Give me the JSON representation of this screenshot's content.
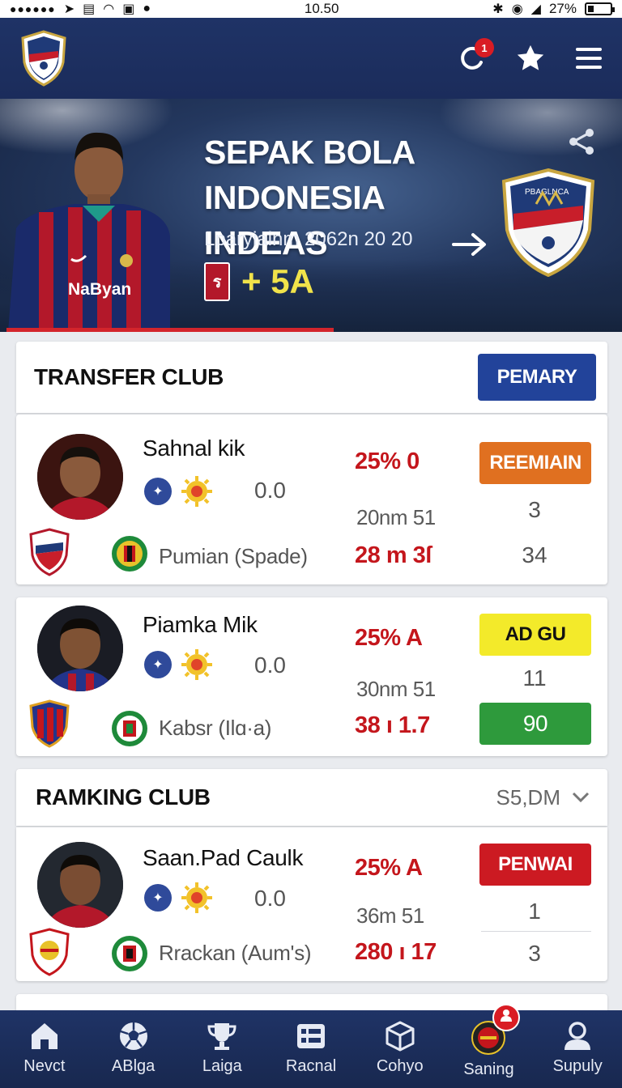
{
  "status_bar": {
    "time": "10.50",
    "battery": "27%"
  },
  "app_bar": {
    "notification_count": "1"
  },
  "hero": {
    "title_line1": "SEPAK BOLA INDONESIA",
    "title_line2": "INDEAS",
    "subtitle": "Lparyiainm 2062n 20 20",
    "score_icon": "ร",
    "score_value": "+ 5A",
    "crest_text": "PBAGLNCA",
    "jersey_text": "NaByan"
  },
  "transfer_section": {
    "title": "TRANSFER CLUB",
    "button_label": "PEMARY",
    "button_color": "#22439a",
    "players": [
      {
        "name": "Sahnal kik",
        "rating": "0.0",
        "league": "Pumian (Sраde)",
        "stat1": "25% 0",
        "stat2": "20nm 51",
        "stat3": "28 m 3ſ",
        "badge": "REEMIAIN",
        "badge_color": "#e07020",
        "right1": "3",
        "right2": "34"
      },
      {
        "name": "Piamka Mik",
        "rating": "0.0",
        "league": "Kabsr (Ilɑ·a)",
        "stat1": "25% A",
        "stat2": "30nm 51",
        "stat3": "38 ı 1.7",
        "badge": "AD GU",
        "badge_color": "#f3ea2a",
        "right1": "11",
        "right2": "90",
        "right2_color": "#2e9a3c"
      }
    ]
  },
  "ranking_section": {
    "title": "RAMKING CLUB",
    "filter_label": "S5,DM",
    "players": [
      {
        "name": "Saan.Pad Caulk",
        "rating": "0.0",
        "league": "Rrackan (Aum's)",
        "stat1": "25% A",
        "stat2": "36m 51",
        "stat3": "280 ı 17",
        "badge": "PENWAI",
        "badge_color": "#cc1a22",
        "right1": "1",
        "right2": "3"
      }
    ]
  },
  "bottom_nav": {
    "items": [
      {
        "label": "Nevct",
        "icon": "home-icon"
      },
      {
        "label": "ABlga",
        "icon": "soccer-ball-icon"
      },
      {
        "label": "Laiga",
        "icon": "trophy-icon"
      },
      {
        "label": "Racnal",
        "icon": "table-icon"
      },
      {
        "label": "Cohyo",
        "icon": "cube-icon"
      },
      {
        "label": "Saning",
        "icon": "club-badge-icon"
      },
      {
        "label": "Supuly",
        "icon": "user-icon"
      }
    ]
  },
  "colors": {
    "navy": "#1f3366",
    "accent_red": "#c4161c",
    "accent_yellow": "#f1e34a"
  }
}
